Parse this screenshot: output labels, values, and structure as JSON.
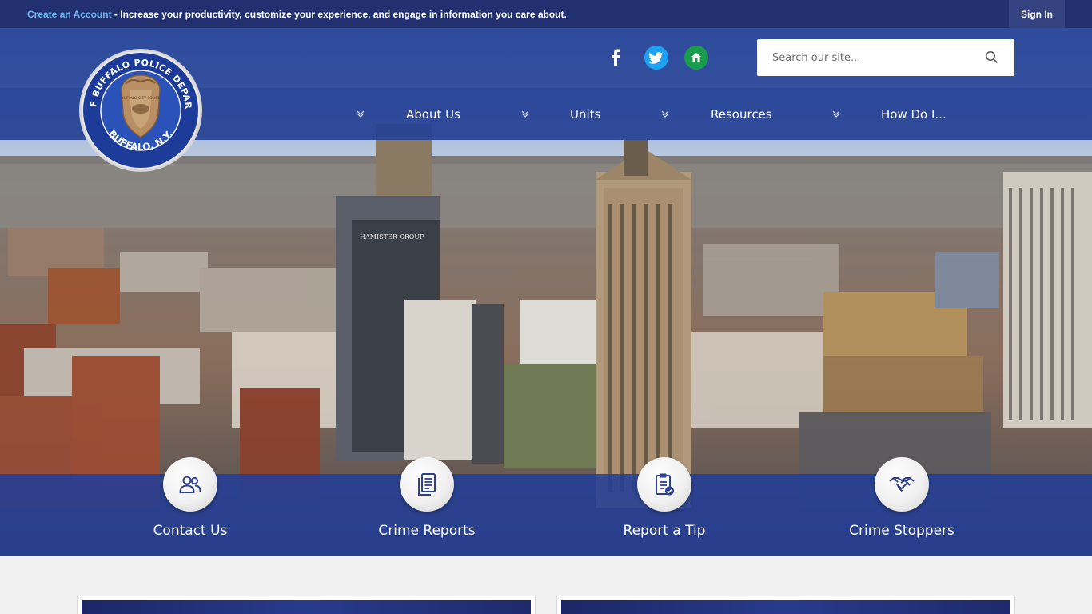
{
  "topbar": {
    "create_account": "Create an Account",
    "message": " - Increase your productivity, customize your experience, and engage in information you care about.",
    "sign_in": "Sign In"
  },
  "seal": {
    "outer_text_top": "SEAL OF BUFFALO POLICE DEPARTMENT",
    "outer_text_bottom": "BUFFALO, N.Y.",
    "badge_text": "BUFFALO CITY POLICE"
  },
  "social": [
    {
      "name": "facebook-icon",
      "color": "#25418f"
    },
    {
      "name": "twitter-icon",
      "color": "#1da1f2"
    },
    {
      "name": "nextdoor-icon",
      "color": "#1a9c4d"
    }
  ],
  "search": {
    "placeholder": "Search our site..."
  },
  "nav": {
    "items": [
      {
        "label": "About Us"
      },
      {
        "label": "Units"
      },
      {
        "label": "Resources"
      },
      {
        "label": "How Do I..."
      }
    ]
  },
  "hero": {
    "building_sign": "HAMISTER GROUP"
  },
  "quick_links": [
    {
      "label": "Contact Us",
      "icon": "people-icon"
    },
    {
      "label": "Crime Reports",
      "icon": "document-icon"
    },
    {
      "label": "Report a Tip",
      "icon": "clipboard-check-icon"
    },
    {
      "label": "Crime Stoppers",
      "icon": "handshake-icon"
    }
  ],
  "colors": {
    "topbar": "#22306f",
    "nav": "#2440a0",
    "accent_link": "#6fb8f2",
    "quick_icon": "#2d3f8f"
  }
}
